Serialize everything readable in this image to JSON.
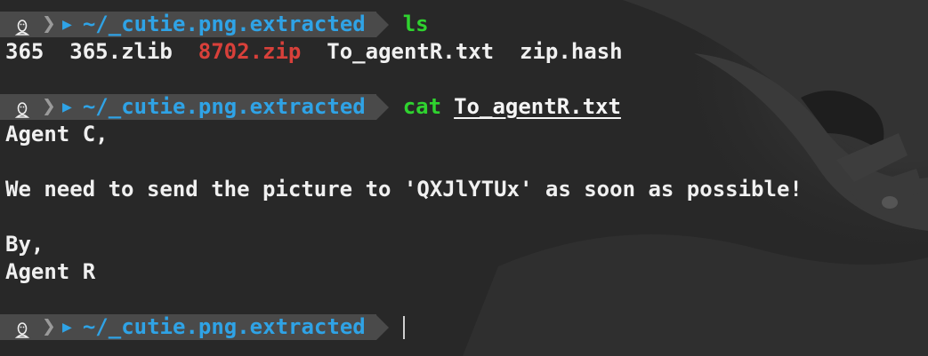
{
  "prompt": {
    "os_icon": "linux-tux-icon",
    "folder_icon": "folder-icon",
    "path": "~/_cutie.png.extracted"
  },
  "commands": {
    "first": "ls",
    "second_cmd": "cat",
    "second_arg": "To_agentR.txt"
  },
  "ls_output": [
    {
      "name": "365",
      "color": "#f0f0f0"
    },
    {
      "name": "365.zlib",
      "color": "#f0f0f0"
    },
    {
      "name": "8702.zip",
      "color": "#d8403a"
    },
    {
      "name": "To_agentR.txt",
      "color": "#f0f0f0"
    },
    {
      "name": "zip.hash",
      "color": "#f0f0f0"
    }
  ],
  "file_content": {
    "line1": "Agent C,",
    "line2": "We need to send the picture to 'QXJlYTUx' as soon as possible!",
    "line3": "By,",
    "line4": "Agent R"
  },
  "colors": {
    "background": "#2a2a2a",
    "prompt_segment": "#4a4a4a",
    "path": "#2fa3e6",
    "command": "#2fd32f",
    "archive": "#d8403a"
  }
}
